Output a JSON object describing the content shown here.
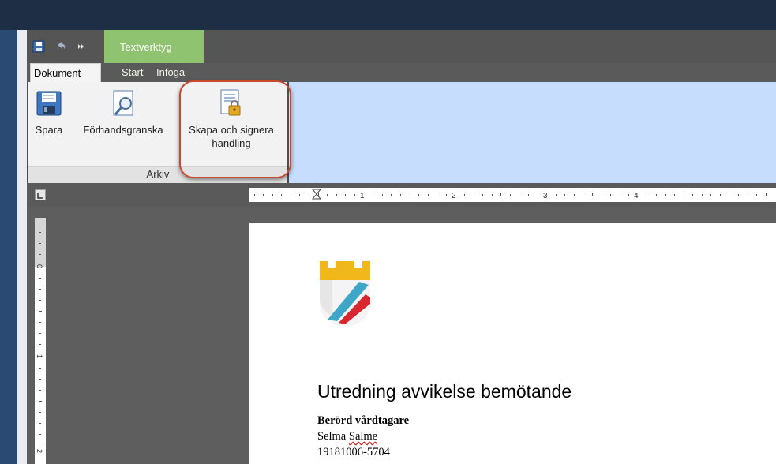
{
  "quick_access": {
    "save_icon": "floppy-save-icon",
    "undo_icon": "undo-icon",
    "more_icon": "more-commands-icon"
  },
  "context_tab": {
    "label": "Textverktyg"
  },
  "tabs": [
    {
      "label": "Dokument",
      "active": true
    },
    {
      "label": "Start",
      "active": false
    },
    {
      "label": "Infoga",
      "active": false
    }
  ],
  "ribbon": {
    "group_label": "Arkiv",
    "buttons": [
      {
        "label": "Spara",
        "icon": "floppy-save-icon"
      },
      {
        "label": "Förhandsgranska",
        "icon": "print-preview-icon"
      },
      {
        "label_line1": "Skapa och signera",
        "label_line2": "handling",
        "icon": "lock-document-icon",
        "highlighted": true
      }
    ]
  },
  "ruler": {
    "h_numbers": [
      "1",
      "2",
      "3",
      "4"
    ],
    "v_numbers": [
      "0",
      "1",
      "2"
    ]
  },
  "document": {
    "title": "Utredning avvikelse bemötande",
    "subheading": "Berörd vårdtagare",
    "name_first": "Selma",
    "name_last": "Salme",
    "personal_number": "19181006-5704"
  },
  "colors": {
    "context_tab": "#8fc370",
    "highlight": "#c9492f",
    "blue_area": "#c6ddfd"
  }
}
